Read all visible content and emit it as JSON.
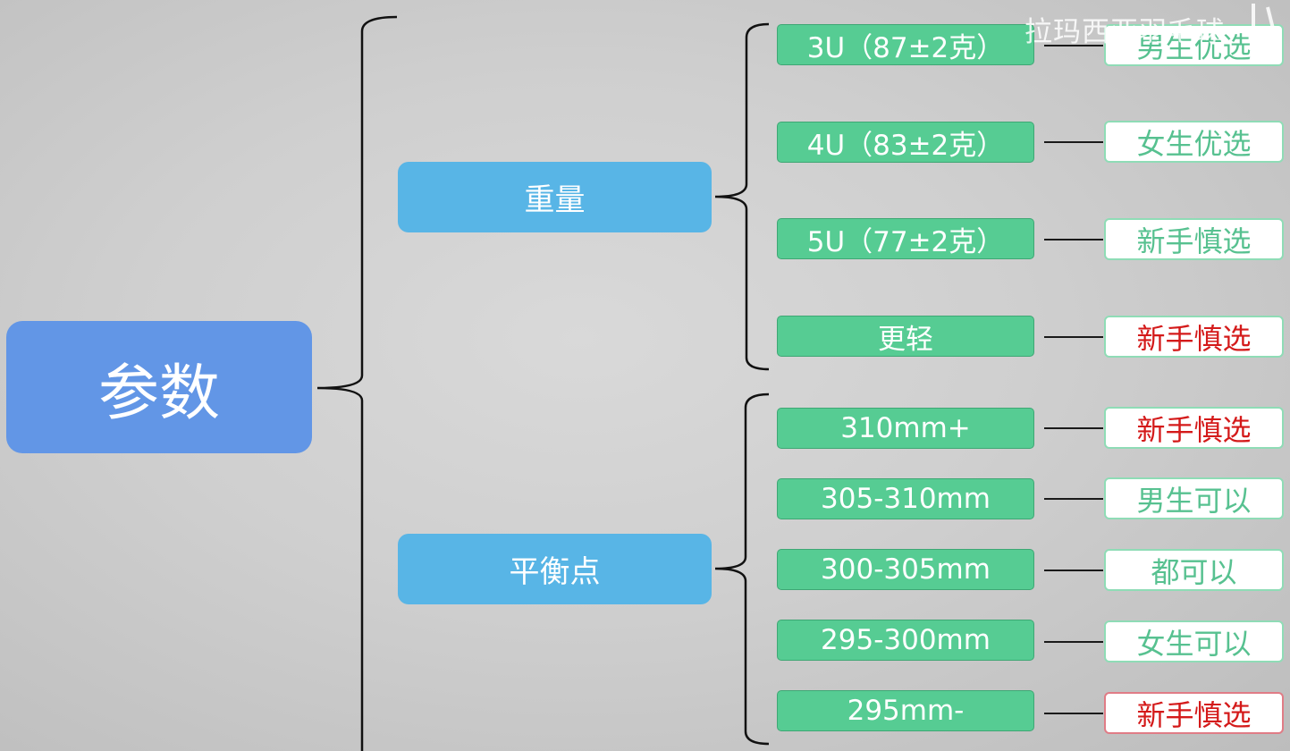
{
  "watermark": "拉玛西亚羽毛球",
  "root": {
    "label": "参数",
    "color": "#6296e6"
  },
  "categories": {
    "weight": {
      "label": "重量",
      "items": [
        {
          "label": "3U（87±2克）",
          "note": "男生优选",
          "tone": "green"
        },
        {
          "label": "4U（83±2克）",
          "note": "女生优选",
          "tone": "green"
        },
        {
          "label": "5U（77±2克）",
          "note": "新手慎选",
          "tone": "green"
        },
        {
          "label": "更轻",
          "note": "新手慎选",
          "tone": "red"
        }
      ]
    },
    "balance": {
      "label": "平衡点",
      "items": [
        {
          "label": "310mm+",
          "note": "新手慎选",
          "tone": "red"
        },
        {
          "label": "305-310mm",
          "note": "男生可以",
          "tone": "green"
        },
        {
          "label": "300-305mm",
          "note": "都可以",
          "tone": "green"
        },
        {
          "label": "295-300mm",
          "note": "女生可以",
          "tone": "green"
        },
        {
          "label": "295mm-",
          "note": "新手慎选",
          "tone": "red"
        }
      ]
    }
  },
  "colors": {
    "category": "#58b5e6",
    "item": "#56cc93",
    "note_green": "#57c190",
    "note_red": "#d41a1a"
  }
}
